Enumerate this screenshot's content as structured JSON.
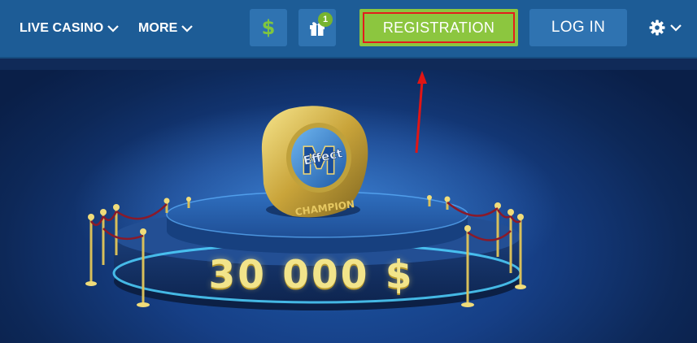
{
  "header": {
    "nav": [
      {
        "label": "LIVE CASINO"
      },
      {
        "label": "MORE"
      }
    ],
    "deposit_icon": "dollar-icon",
    "gift": {
      "icon": "gift-icon",
      "badge_count": "1"
    },
    "registration_label": "REGISTRATION",
    "login_label": "LOG IN",
    "settings_icon": "gear-icon"
  },
  "banner": {
    "ring_text_top": "Effect",
    "ring_letter": "M",
    "ring_text_bottom": "CHAMPION",
    "prize": "30 000 $"
  },
  "colors": {
    "header_bg": "#1d5c96",
    "button_bg": "#2f73b1",
    "registration_green": "#8cc63f",
    "highlight_red": "#e31c1c",
    "dollar_green": "#7fc63f",
    "prize_gold": "#f2e48a"
  }
}
